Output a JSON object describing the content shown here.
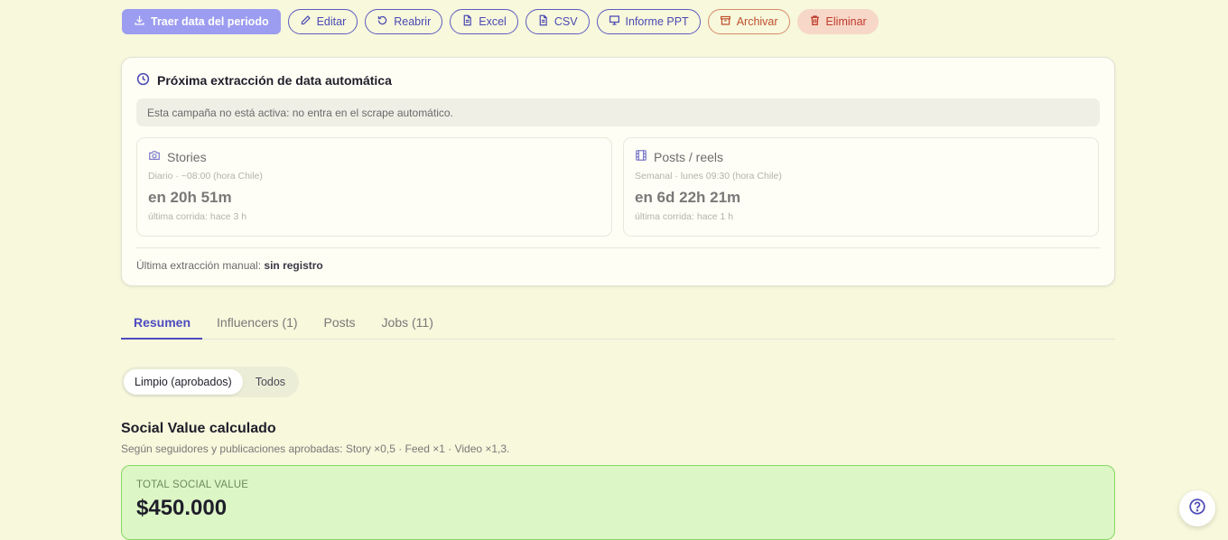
{
  "toolbar": {
    "fetch_label": "Traer data del periodo",
    "edit_label": "Editar",
    "reopen_label": "Reabrir",
    "excel_label": "Excel",
    "csv_label": "CSV",
    "ppt_label": "Informe PPT",
    "archive_label": "Archivar",
    "delete_label": "Eliminar"
  },
  "extraction": {
    "title": "Próxima extracción de data automática",
    "notice": "Esta campaña no está activa: no entra en el scrape automático.",
    "stories": {
      "title": "Stories",
      "schedule": "Diario · ~08:00 (hora Chile)",
      "countdown": "en 20h 51m",
      "last_run": "última corrida: hace 3 h"
    },
    "posts": {
      "title": "Posts / reels",
      "schedule": "Semanal · lunes 09:30 (hora Chile)",
      "countdown": "en 6d 22h 21m",
      "last_run": "última corrida: hace 1 h"
    },
    "manual_label": "Última extracción manual:",
    "manual_value": "sin registro"
  },
  "tabs": [
    {
      "label": "Resumen"
    },
    {
      "label": "Influencers (1)"
    },
    {
      "label": "Posts"
    },
    {
      "label": "Jobs (11)"
    }
  ],
  "filter": {
    "clean_label": "Limpio (aprobados)",
    "all_label": "Todos"
  },
  "social_value": {
    "title": "Social Value calculado",
    "subtitle": "Según seguidores y publicaciones aprobadas: Story ×0,5 · Feed ×1 · Video ×1,3.",
    "total_label": "TOTAL SOCIAL VALUE",
    "total_value": "$450.000"
  },
  "colors": {
    "background": "#f7f8dc",
    "accent": "#4d4bbf",
    "danger": "#c0392b",
    "success_bg": "#ddf6c5"
  }
}
